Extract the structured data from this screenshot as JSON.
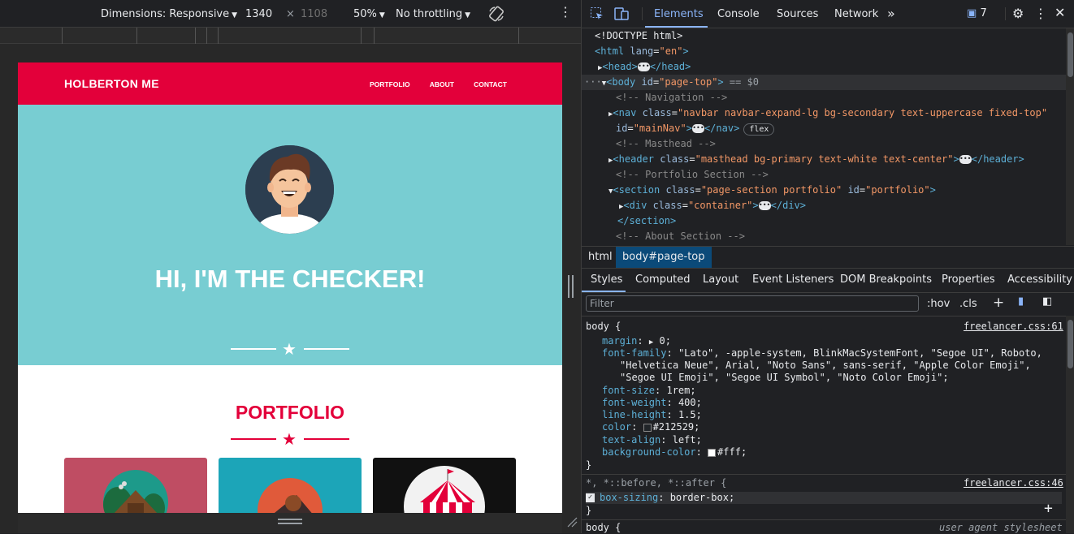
{
  "toolbar": {
    "dimensions_label": "Dimensions: Responsive",
    "width": "1340",
    "times": "×",
    "height": "1108",
    "zoom": "50%",
    "throttling": "No throttling"
  },
  "site": {
    "brand": "HOLBERTON ME",
    "nav": [
      "PORTFOLIO",
      "ABOUT",
      "CONTACT"
    ],
    "masthead_title": "HI, I'M THE CHECKER!",
    "portfolio_title": "PORTFOLIO",
    "colors": {
      "primary": "#e3003a",
      "teal": "#78cdd2"
    }
  },
  "devtools": {
    "tabs": [
      "Elements",
      "Console",
      "Sources",
      "Network"
    ],
    "more_tabs": "»",
    "issues_count": "7",
    "breadcrumbs": [
      "html",
      "body#page-top"
    ],
    "style_tabs": [
      "Styles",
      "Computed",
      "Layout",
      "Event Listeners",
      "DOM Breakpoints",
      "Properties",
      "Accessibility"
    ],
    "filter_placeholder": "Filter",
    "hov": ":hov",
    "cls": ".cls",
    "dom": {
      "doctype": "<!DOCTYPE html>",
      "html_tag": "html",
      "lang_attr": "lang",
      "lang_val": "\"en\"",
      "head": "head",
      "body_tag": "body",
      "body_id_attr": "id",
      "body_id_val": "\"page-top\"",
      "body_eq": "== $0",
      "c_nav": "<!-- Navigation -->",
      "nav_tag": "nav",
      "nav_class_attr": "class",
      "nav_class_val": "\"navbar navbar-expand-lg bg-secondary text-uppercase fixed-top\"",
      "nav_id_attr": "id",
      "nav_id_val": "\"mainNav\"",
      "flex_badge": "flex",
      "c_masthead": "<!-- Masthead -->",
      "header_tag": "header",
      "header_class_attr": "class",
      "header_class_val": "\"masthead bg-primary text-white text-center\"",
      "c_portfolio": "<!-- Portfolio Section -->",
      "section_tag": "section",
      "section_class_attr": "class",
      "section_class_val": "\"page-section portfolio\"",
      "section_id_attr": "id",
      "section_id_val": "\"portfolio\"",
      "div_tag": "div",
      "div_class_attr": "class",
      "div_class_val": "\"container\"",
      "c_about": "<!-- About Section -->"
    },
    "styles": {
      "body_selector": "body {",
      "body_source": "freelancer.css:61",
      "margin_prop": "margin",
      "margin_val": "0;",
      "ff_prop": "font-family",
      "ff_val1": "\"Lato\", -apple-system, BlinkMacSystemFont, \"Segoe UI\", Roboto,",
      "ff_val2": "\"Helvetica Neue\", Arial, \"Noto Sans\", sans-serif, \"Apple Color Emoji\",",
      "ff_val3": "\"Segoe UI Emoji\", \"Segoe UI Symbol\", \"Noto Color Emoji\";",
      "fs_prop": "font-size",
      "fs_val": "1rem;",
      "fw_prop": "font-weight",
      "fw_val": "400;",
      "lh_prop": "line-height",
      "lh_val": "1.5;",
      "color_prop": "color",
      "color_val": "#212529;",
      "ta_prop": "text-align",
      "ta_val": "left;",
      "bg_prop": "background-color",
      "bg_val": "#fff;",
      "close_brace": "}",
      "univ_selector": "*, *::before, *::after {",
      "univ_source": "freelancer.css:46",
      "bs_prop": "box-sizing",
      "bs_val": "border-box;",
      "close_brace2": "}",
      "body2_selector": "body {",
      "ua_source": "user agent stylesheet"
    }
  }
}
